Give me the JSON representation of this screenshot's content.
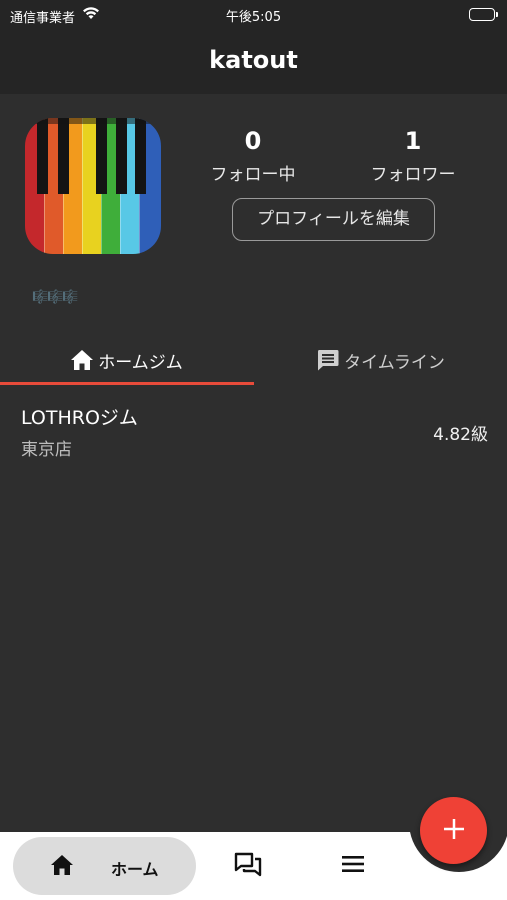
{
  "status_bar": {
    "carrier": "通信事業者",
    "time": "午後5:05"
  },
  "header": {
    "title": "katout"
  },
  "profile": {
    "following_count": "0",
    "following_label": "フォロー中",
    "followers_count": "1",
    "followers_label": "フォロワー",
    "edit_button": "プロフィールを編集",
    "badges": "🎼🎼🎼"
  },
  "tabs": {
    "home_gym": "ホームジム",
    "timeline": "タイムライン"
  },
  "home_gyms": [
    {
      "name": "LOTHROジム",
      "branch": "東京店",
      "grade": "4.82級"
    }
  ],
  "bottom_nav": {
    "home_label": "ホーム"
  },
  "colors": {
    "accent": "#ef4136",
    "tab_indicator": "#e84b3a",
    "background": "#2e2e2e",
    "header": "#252525"
  },
  "icons": {
    "wifi": "wifi-icon",
    "battery": "battery-icon",
    "home": "home-icon",
    "timeline": "chat-bubble-icon",
    "chat": "chat-icon",
    "menu": "menu-icon",
    "add": "plus-icon"
  }
}
